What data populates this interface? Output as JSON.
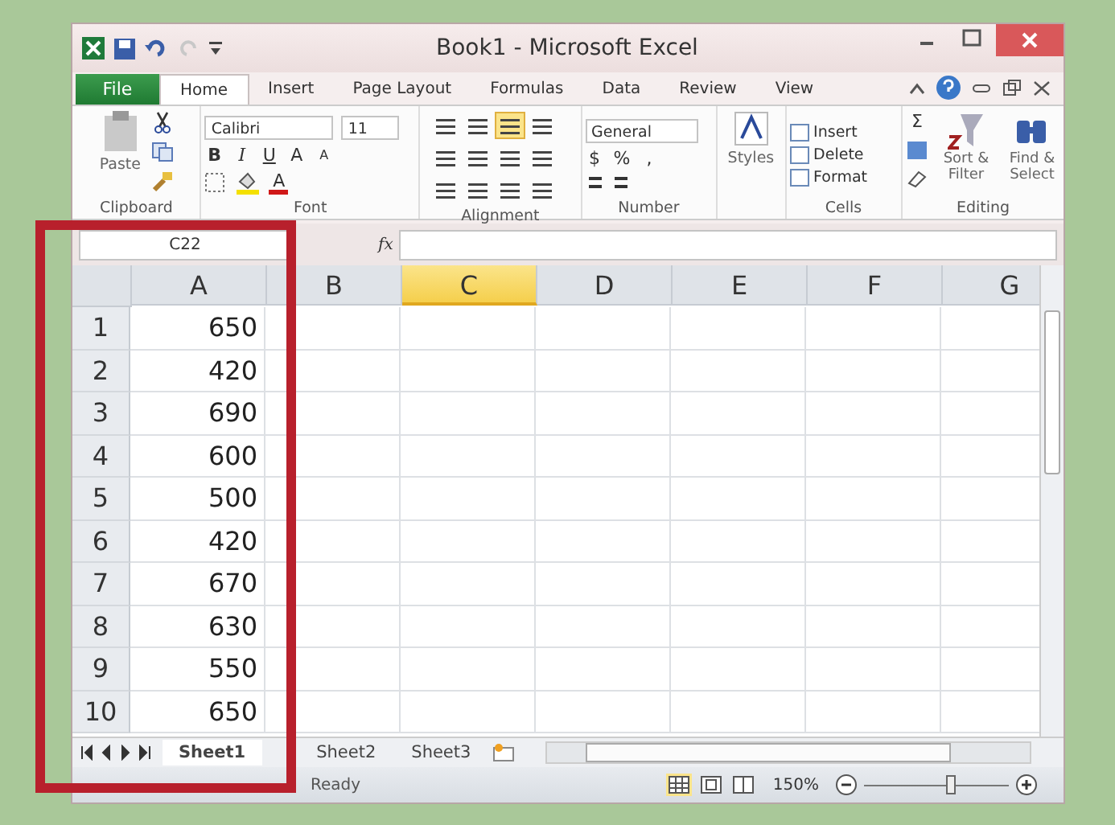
{
  "window": {
    "title": "Book1 - Microsoft Excel"
  },
  "file_tab": "File",
  "tabs": [
    {
      "label": "Home",
      "selected": true
    },
    {
      "label": "Insert",
      "selected": false
    },
    {
      "label": "Page Layout",
      "selected": false
    },
    {
      "label": "Formulas",
      "selected": false
    },
    {
      "label": "Data",
      "selected": false
    },
    {
      "label": "Review",
      "selected": false
    },
    {
      "label": "View",
      "selected": false
    }
  ],
  "ribbon": {
    "clipboard": {
      "label": "Clipboard",
      "paste": "Paste"
    },
    "font": {
      "label": "Font",
      "family": "Calibri",
      "size": "11",
      "bold": "B",
      "italic": "I",
      "underline": "U",
      "grow": "A",
      "shrink": "A",
      "font_color_label": "A"
    },
    "alignment": {
      "label": "Alignment"
    },
    "number": {
      "label": "Number",
      "format": "General",
      "currency": "$",
      "percent": "%",
      "comma": ","
    },
    "styles": {
      "label": "Styles"
    },
    "cells": {
      "label": "Cells",
      "items": [
        "Insert",
        "Delete",
        "Format"
      ]
    },
    "editing": {
      "label": "Editing",
      "sum": "Σ",
      "sort": "Sort & Filter",
      "find": "Find & Select"
    }
  },
  "name_box": "C22",
  "fx": "fx",
  "columns": [
    {
      "label": "A",
      "selected": false
    },
    {
      "label": "B",
      "selected": false
    },
    {
      "label": "C",
      "selected": true
    },
    {
      "label": "D",
      "selected": false
    },
    {
      "label": "E",
      "selected": false
    },
    {
      "label": "F",
      "selected": false
    },
    {
      "label": "G",
      "selected": false
    }
  ],
  "rows": [
    {
      "n": "1",
      "a": "650"
    },
    {
      "n": "2",
      "a": "420"
    },
    {
      "n": "3",
      "a": "690"
    },
    {
      "n": "4",
      "a": "600"
    },
    {
      "n": "5",
      "a": "500"
    },
    {
      "n": "6",
      "a": "420"
    },
    {
      "n": "7",
      "a": "670"
    },
    {
      "n": "8",
      "a": "630"
    },
    {
      "n": "9",
      "a": "550"
    },
    {
      "n": "10",
      "a": "650"
    }
  ],
  "sheets": [
    {
      "label": "Sheet1",
      "selected": true
    },
    {
      "label": "Sheet2",
      "selected": false
    },
    {
      "label": "Sheet3",
      "selected": false
    }
  ],
  "status_bar": {
    "text": "Ready",
    "zoom": "150%",
    "level": 0.6
  }
}
